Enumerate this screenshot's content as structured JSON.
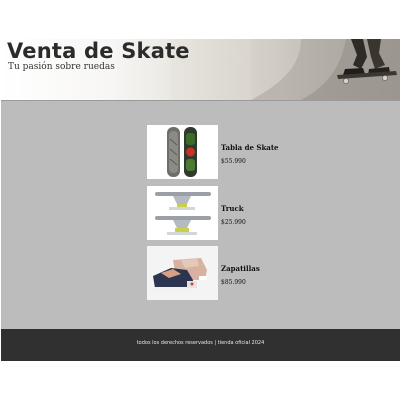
{
  "header": {
    "title": "Venta de Skate",
    "tagline": "Tu pasión sobre ruedas"
  },
  "products": [
    {
      "name": "Tabla de Skate",
      "price": "$55.990",
      "image_icon": "skateboard-decks-icon"
    },
    {
      "name": "Truck",
      "price": "$25.990",
      "image_icon": "skate-trucks-icon"
    },
    {
      "name": "Zapatillas",
      "price": "$85.990",
      "image_icon": "sneaker-icon"
    }
  ],
  "footer": {
    "text": "todos los derechos reservados | tienda oficial 2024"
  },
  "colors": {
    "page_bg": "#bdbcbd",
    "footer_bg": "#303030",
    "title_color": "#2b2b2b"
  }
}
